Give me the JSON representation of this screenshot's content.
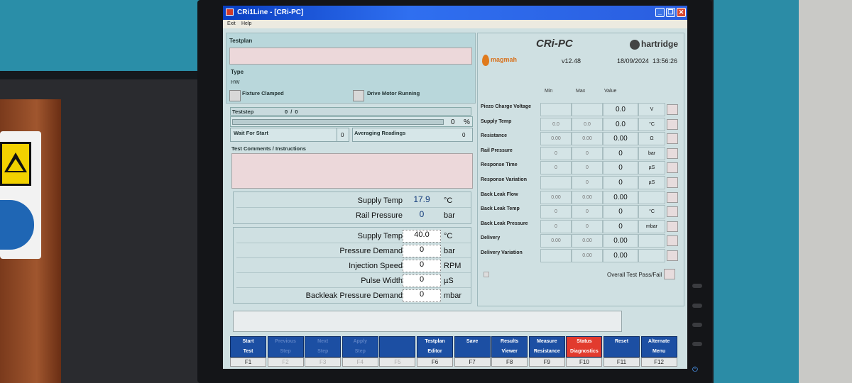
{
  "window": {
    "title": "CRi1Line - [CRi-PC]"
  },
  "menu": {
    "items": [
      "Exit",
      "Help"
    ]
  },
  "left": {
    "testplan_label": "Testplan",
    "type_label": "Type",
    "type_value": "HW",
    "fixture_clamped": "Fixture Clamped",
    "drive_motor": "Drive Motor Running",
    "teststep_label": "Teststep",
    "teststep_value": "0 / 0",
    "progress_value": "0",
    "progress_unit": "%",
    "wait_label": "Wait For Start",
    "wait_value": "0",
    "avg_label": "Averaging Readings",
    "avg_value": "0",
    "comments_label": "Test Comments / Instructions",
    "readings": [
      {
        "label": "Supply Temp",
        "value": "17.9",
        "unit": "°C"
      },
      {
        "label": "Rail Pressure",
        "value": "0",
        "unit": "bar"
      }
    ],
    "demands": [
      {
        "label": "Supply Temp",
        "value": "40.0",
        "unit": "°C"
      },
      {
        "label": "Pressure Demand",
        "value": "0",
        "unit": "bar"
      },
      {
        "label": "Injection Speed",
        "value": "0",
        "unit": "RPM"
      },
      {
        "label": "Pulse Width",
        "value": "0",
        "unit": "µS"
      },
      {
        "label": "Backleak Pressure Demand",
        "value": "0",
        "unit": "mbar"
      }
    ]
  },
  "right": {
    "product": "CRi-PC",
    "brand": "hartridge",
    "magmah": "magmah",
    "version": "v12.48",
    "date": "18/09/2024",
    "time": "13:56:26",
    "headers": {
      "min": "Min",
      "max": "Max",
      "value": "Value"
    },
    "measurements": [
      {
        "name": "Piezo Charge Voltage",
        "min": "",
        "max": "",
        "value": "0.0",
        "unit": "V"
      },
      {
        "name": "Supply Temp",
        "min": "0.0",
        "max": "0.0",
        "value": "0.0",
        "unit": "°C"
      },
      {
        "name": "Resistance",
        "min": "0.00",
        "max": "0.00",
        "value": "0.00",
        "unit": "Ω"
      },
      {
        "name": "Rail Pressure",
        "min": "0",
        "max": "0",
        "value": "0",
        "unit": "bar"
      },
      {
        "name": "Response Time",
        "min": "0",
        "max": "0",
        "value": "0",
        "unit": "µS"
      },
      {
        "name": "Response Variation",
        "min": "",
        "max": "0",
        "value": "0",
        "unit": "µS"
      },
      {
        "name": "Back Leak Flow",
        "min": "0.00",
        "max": "0.00",
        "value": "0.00",
        "unit": ""
      },
      {
        "name": "Back Leak Temp",
        "min": "0",
        "max": "0",
        "value": "0",
        "unit": "°C"
      },
      {
        "name": "Back Leak Pressure",
        "min": "0",
        "max": "0",
        "value": "0",
        "unit": "mbar"
      },
      {
        "name": "Delivery",
        "min": "0.00",
        "max": "0.00",
        "value": "0.00",
        "unit": ""
      },
      {
        "name": "Delivery Variation",
        "min": "",
        "max": "0.00",
        "value": "0.00",
        "unit": ""
      }
    ],
    "overall_label": "Overall Test Pass/Fail"
  },
  "fkeys": [
    {
      "l1": "Start",
      "l2": "Test",
      "key": "F1",
      "style": "normal"
    },
    {
      "l1": "Previous",
      "l2": "Step",
      "key": "F2",
      "style": "dim"
    },
    {
      "l1": "Next",
      "l2": "Step",
      "key": "F3",
      "style": "dim"
    },
    {
      "l1": "Apply",
      "l2": "Step",
      "key": "F4",
      "style": "dim"
    },
    {
      "l1": "",
      "l2": "",
      "key": "F5",
      "style": "dim"
    },
    {
      "l1": "Testplan",
      "l2": "Editor",
      "key": "F6",
      "style": "normal"
    },
    {
      "l1": "Save",
      "l2": "",
      "key": "F7",
      "style": "normal"
    },
    {
      "l1": "Results",
      "l2": "Viewer",
      "key": "F8",
      "style": "normal"
    },
    {
      "l1": "Measure",
      "l2": "Resistance",
      "key": "F9",
      "style": "normal"
    },
    {
      "l1": "Status",
      "l2": "Diagnostics",
      "key": "F10",
      "style": "red"
    },
    {
      "l1": "Reset",
      "l2": "",
      "key": "F11",
      "style": "normal"
    },
    {
      "l1": "Alternate",
      "l2": "Menu",
      "key": "F12",
      "style": "normal"
    }
  ]
}
